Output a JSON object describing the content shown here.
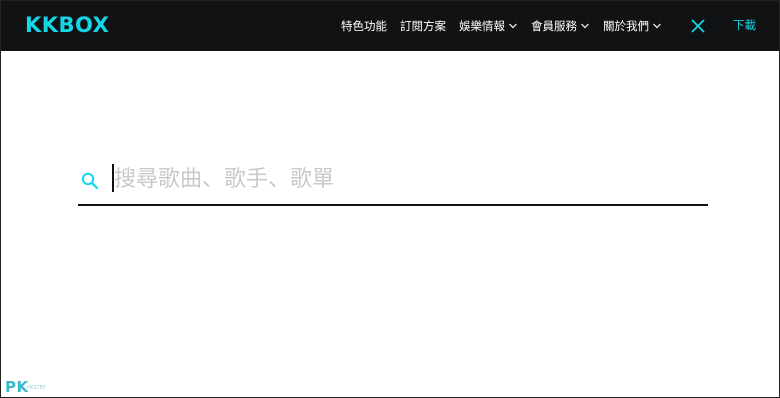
{
  "header": {
    "logo": "KKBOX",
    "nav": [
      {
        "label": "特色功能",
        "has_dropdown": false
      },
      {
        "label": "訂閱方案",
        "has_dropdown": false
      },
      {
        "label": "娛樂情報",
        "has_dropdown": true
      },
      {
        "label": "會員服務",
        "has_dropdown": true
      },
      {
        "label": "關於我們",
        "has_dropdown": true
      }
    ],
    "close_icon": "close-icon",
    "download_label": "下載"
  },
  "search": {
    "icon": "search-icon",
    "placeholder": "搜尋歌曲、歌手、歌單",
    "value": ""
  },
  "watermark": {
    "text": "PK",
    "subtext": "PKSTEP"
  },
  "colors": {
    "topbar_bg": "#111214",
    "accent": "#13d6e6",
    "nav_text": "#ffffff",
    "placeholder": "#c9c9c9"
  }
}
